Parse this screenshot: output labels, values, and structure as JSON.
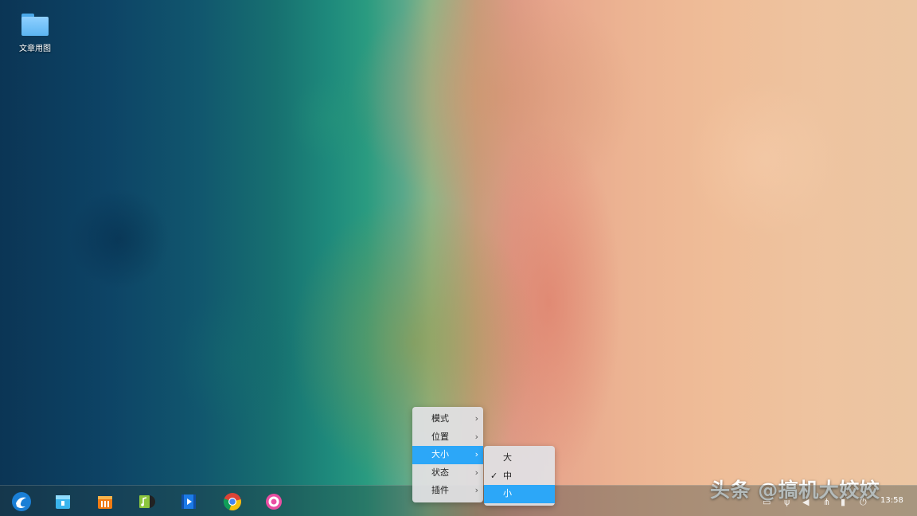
{
  "desktop": {
    "icons": [
      {
        "label": "文章用图",
        "icon": "folder-icon"
      }
    ]
  },
  "watermark": "头条 @搞机大姣姣",
  "taskbar": {
    "apps": [
      {
        "name": "launcher",
        "icon": "deepin-launcher-icon"
      },
      {
        "name": "file-manager",
        "icon": "file-manager-icon"
      },
      {
        "name": "app-store",
        "icon": "app-store-icon"
      },
      {
        "name": "music",
        "icon": "music-icon"
      },
      {
        "name": "video",
        "icon": "video-player-icon"
      },
      {
        "name": "browser",
        "icon": "chrome-icon"
      },
      {
        "name": "settings",
        "icon": "settings-gear-icon"
      }
    ],
    "clock": "13:58"
  },
  "context_menu": {
    "items": [
      {
        "label": "模式",
        "has_submenu": true
      },
      {
        "label": "位置",
        "has_submenu": true
      },
      {
        "label": "大小",
        "has_submenu": true,
        "active": true
      },
      {
        "label": "状态",
        "has_submenu": true
      },
      {
        "label": "插件",
        "has_submenu": true
      }
    ],
    "arrow": "›"
  },
  "size_submenu": {
    "items": [
      {
        "label": "大",
        "checked": false
      },
      {
        "label": "中",
        "checked": true
      },
      {
        "label": "小",
        "checked": false,
        "active": true
      }
    ],
    "check": "✓"
  },
  "colors": {
    "menu_highlight": "#2ca7f8",
    "folder": "#5cb5f2"
  }
}
